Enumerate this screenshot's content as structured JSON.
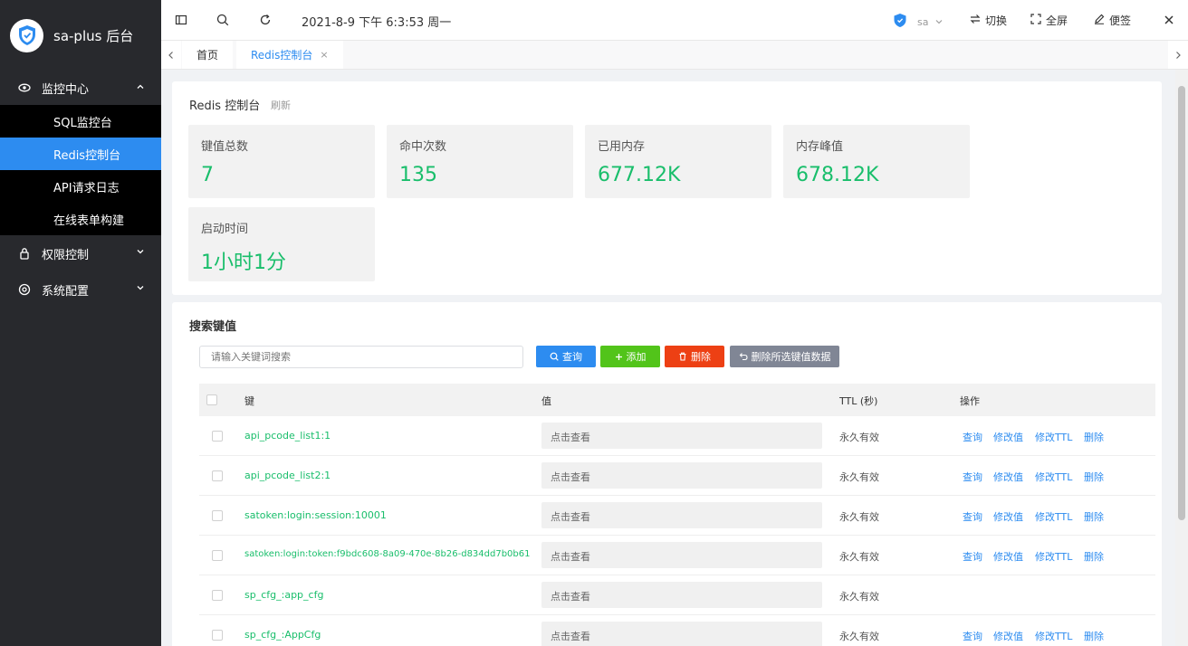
{
  "app": {
    "name": "sa-plus 后台"
  },
  "sidebar": {
    "groups": [
      {
        "label": "监控中心",
        "expanded": true,
        "items": [
          {
            "label": "SQL监控台",
            "active": false
          },
          {
            "label": "Redis控制台",
            "active": true
          },
          {
            "label": "API请求日志",
            "active": false
          },
          {
            "label": "在线表单构建",
            "active": false
          }
        ]
      },
      {
        "label": "权限控制",
        "expanded": false
      },
      {
        "label": "系统配置",
        "expanded": false
      }
    ]
  },
  "topbar": {
    "datetime": "2021-8-9 下午 6:3:53 周一",
    "user_label": "sa",
    "switch_label": "切换",
    "fullscreen_label": "全屏",
    "note_label": "便签"
  },
  "tabs": [
    {
      "label": "首页",
      "active": false
    },
    {
      "label": "Redis控制台",
      "active": true,
      "close": "×"
    }
  ],
  "redis_panel": {
    "title": "Redis 控制台",
    "subtitle": "刷新",
    "stats": [
      {
        "label": "键值总数",
        "value": "7"
      },
      {
        "label": "命中次数",
        "value": "135"
      },
      {
        "label": "已用内存",
        "value": "677.12K"
      },
      {
        "label": "内存峰值",
        "value": "678.12K"
      },
      {
        "label": "启动时间",
        "value": "1小时1分"
      }
    ]
  },
  "search_panel": {
    "title": "搜索键值",
    "input_placeholder": "请输入关键词搜索",
    "buttons": {
      "query": "查询",
      "add": "添加",
      "delete": "删除",
      "batch_delete": "删除所选键值数据"
    },
    "columns": {
      "key": "键",
      "value": "值",
      "ttl": "TTL (秒)",
      "ops": "操作"
    },
    "rows": [
      {
        "key": "api_pcode_list1:1",
        "value": "点击查看",
        "ttl": "永久有效",
        "actions": [
          "查询",
          "修改值",
          "修改TTL",
          "删除"
        ]
      },
      {
        "key": "api_pcode_list2:1",
        "value": "点击查看",
        "ttl": "永久有效",
        "actions": [
          "查询",
          "修改值",
          "修改TTL",
          "删除"
        ]
      },
      {
        "key": "satoken:login:session:10001",
        "value": "点击查看",
        "ttl": "永久有效",
        "actions": [
          "查询",
          "修改值",
          "修改TTL",
          "删除"
        ]
      },
      {
        "key": "satoken:login:token:f9bdc608-8a09-470e-8b26-d834dd7b0b61",
        "value": "点击查看",
        "ttl": "永久有效",
        "actions": [
          "查询",
          "修改值",
          "修改TTL",
          "删除"
        ]
      },
      {
        "key": "sp_cfg_:app_cfg",
        "value": "点击查看",
        "ttl": "永久有效",
        "actions": []
      },
      {
        "key": "sp_cfg_:AppCfg",
        "value": "点击查看",
        "ttl": "永久有效",
        "actions": [
          "查询",
          "修改值",
          "修改TTL",
          "删除"
        ]
      }
    ]
  },
  "colors": {
    "sidebar_bg": "#28292d",
    "submenu_bg": "#000000",
    "accent": "#2d8cf0",
    "success": "#19be6b",
    "danger": "#ed4014",
    "gray_button": "#808695"
  }
}
